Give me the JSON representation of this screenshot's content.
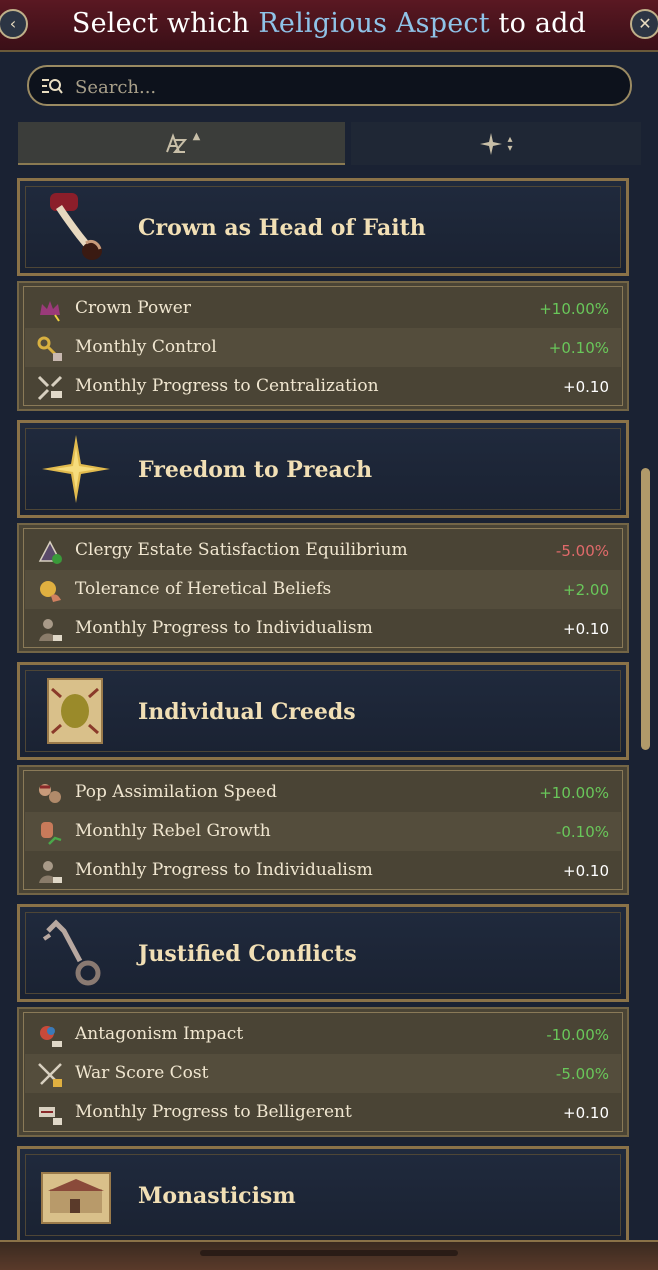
{
  "header": {
    "title_prefix": "Select which",
    "title_accent": "Religious Aspect",
    "title_suffix": "to add",
    "back_icon": "chevron-left-icon",
    "close_icon": "close-icon"
  },
  "search": {
    "placeholder": "Search...",
    "value": ""
  },
  "sort": {
    "alpha_label": "AZ",
    "alpha_icon": "sort-alphabetical-icon",
    "effect_icon": "sort-effect-icon"
  },
  "aspects": [
    {
      "name": "Crown as Head of Faith",
      "icon": "hand-icon",
      "effects": [
        {
          "label": "Crown Power",
          "value": "+10.00%",
          "tone": "pos",
          "icon": "crown-power-icon"
        },
        {
          "label": "Monthly Control",
          "value": "+0.10%",
          "tone": "pos",
          "icon": "key-control-icon"
        },
        {
          "label": "Monthly Progress to Centralization",
          "value": "+0.10",
          "tone": "neu",
          "icon": "centralization-icon"
        }
      ]
    },
    {
      "name": "Freedom to Preach",
      "icon": "star-icon",
      "effects": [
        {
          "label": "Clergy Estate Satisfaction Equilibrium",
          "value": "-5.00%",
          "tone": "neg",
          "icon": "clergy-icon"
        },
        {
          "label": "Tolerance of Heretical Beliefs",
          "value": "+2.00",
          "tone": "pos",
          "icon": "tolerance-icon"
        },
        {
          "label": "Monthly Progress to Individualism",
          "value": "+0.10",
          "tone": "neu",
          "icon": "individualism-icon"
        }
      ]
    },
    {
      "name": "Individual Creeds",
      "icon": "scroll-icon",
      "effects": [
        {
          "label": "Pop Assimilation Speed",
          "value": "+10.00%",
          "tone": "pos",
          "icon": "assimilation-icon"
        },
        {
          "label": "Monthly Rebel Growth",
          "value": "-0.10%",
          "tone": "pos",
          "icon": "rebel-icon"
        },
        {
          "label": "Monthly Progress to Individualism",
          "value": "+0.10",
          "tone": "neu",
          "icon": "individualism-icon"
        }
      ]
    },
    {
      "name": "Justified Conflicts",
      "icon": "key-icon",
      "effects": [
        {
          "label": "Antagonism Impact",
          "value": "-10.00%",
          "tone": "pos",
          "icon": "antagonism-icon"
        },
        {
          "label": "War Score Cost",
          "value": "-5.00%",
          "tone": "pos",
          "icon": "swords-icon"
        },
        {
          "label": "Monthly Progress to Belligerent",
          "value": "+0.10",
          "tone": "neu",
          "icon": "belligerent-icon"
        }
      ]
    },
    {
      "name": "Monasticism",
      "icon": "monastery-icon",
      "effects": []
    }
  ],
  "colors": {
    "positive": "#69c75a",
    "negative": "#e06a6a",
    "accent": "#8fc3e8",
    "frame": "#8a7248"
  }
}
